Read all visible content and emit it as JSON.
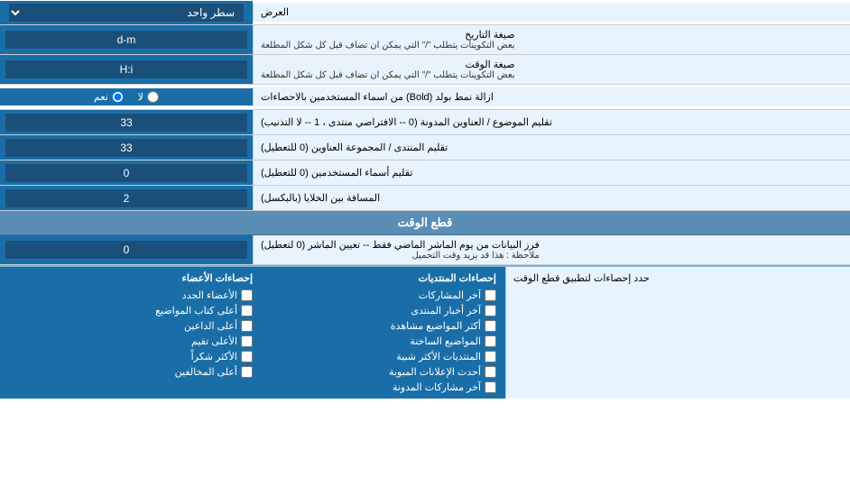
{
  "header": {
    "display_label": "العرض",
    "single_line": "سطر واحد"
  },
  "rows": [
    {
      "id": "date_format",
      "label": "صيغة التاريخ",
      "sublabel": "بعض التكوينات يتطلب \"/\" التي يمكن ان تضاف قبل كل شكل المطلعة",
      "value": "d-m"
    },
    {
      "id": "time_format",
      "label": "صيغة الوقت",
      "sublabel": "بعض التكوينات يتطلب \"/\" التي يمكن ان تضاف قبل كل شكل المطلعة",
      "value": "H:i"
    },
    {
      "id": "bold_remove",
      "label": "ازالة نمط بولد (Bold) من اسماء المستخدمين بالاحصاءات",
      "type": "radio",
      "options": [
        {
          "label": "نعم",
          "value": "yes",
          "checked": true
        },
        {
          "label": "لا",
          "value": "no",
          "checked": false
        }
      ]
    },
    {
      "id": "topic_title",
      "label": "تقليم الموضوع / العناوين المدونة (0 -- الافتراضي منتدى ، 1 -- لا التذنيب)",
      "value": "33"
    },
    {
      "id": "forum_title",
      "label": "تقليم المنتدى / المجموعة العناوين (0 للتعطيل)",
      "value": "33"
    },
    {
      "id": "username_trim",
      "label": "تقليم أسماء المستخدمين (0 للتعطيل)",
      "value": "0"
    },
    {
      "id": "cell_spacing",
      "label": "المسافة بين الخلايا (بالبكسل)",
      "value": "2"
    }
  ],
  "time_cut_section": {
    "header": "قطع الوقت",
    "row": {
      "label": "فرز البيانات من يوم الماشر الماضي فقط -- تعيين الماشر (0 لتعطيل)",
      "note": "ملاحظة : هذا قد يزيد وقت التحميل",
      "value": "0"
    },
    "stats_label": "حدد إحصاءات لتطبيق قطع الوقت"
  },
  "checkboxes": {
    "col1": {
      "header": "إحصاءات المنتديات",
      "items": [
        {
          "label": "آخر المشاركات",
          "checked": false
        },
        {
          "label": "آخر أخبار المنتدى",
          "checked": false
        },
        {
          "label": "أكثر المواضيع مشاهدة",
          "checked": false
        },
        {
          "label": "المواضيع الساخنة",
          "checked": false
        },
        {
          "label": "المنتديات الأكثر شبية",
          "checked": false
        },
        {
          "label": "أحدث الإعلانات المبوبة",
          "checked": false
        },
        {
          "label": "آخر مشاركات المدونة",
          "checked": false
        }
      ]
    },
    "col2": {
      "header": "إحصاءات الأعضاء",
      "items": [
        {
          "label": "الأعضاء الجدد",
          "checked": false
        },
        {
          "label": "أعلى كتاب المواضيع",
          "checked": false
        },
        {
          "label": "أعلى الداعين",
          "checked": false
        },
        {
          "label": "الأعلى تقيم",
          "checked": false
        },
        {
          "label": "الأكثر شكراً",
          "checked": false
        },
        {
          "label": "أعلى المخالفين",
          "checked": false
        }
      ]
    }
  }
}
